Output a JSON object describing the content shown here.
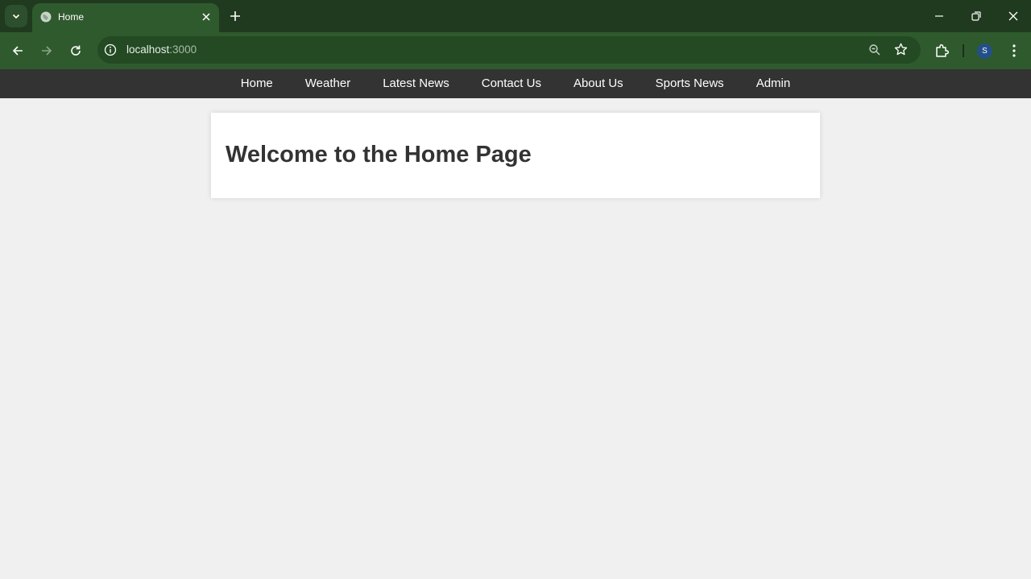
{
  "browser": {
    "tab": {
      "title": "Home"
    },
    "address": {
      "host": "localhost",
      "port": ":3000"
    },
    "profile_initial": "S",
    "colors": {
      "tabstrip": "#1f3a1f",
      "toolbar": "#2f5a2e",
      "omnibox": "#244a24",
      "avatar": "#23508a"
    },
    "icons": {
      "tab_search": "chevron-down-icon",
      "favicon": "globe-icon",
      "tab_close": "close-icon",
      "new_tab": "plus-icon",
      "minimize": "minimize-icon",
      "restore": "restore-icon",
      "close_window": "close-icon",
      "back": "arrow-left-icon",
      "forward": "arrow-right-icon",
      "reload": "reload-icon",
      "site_info": "info-icon",
      "zoom": "zoom-icon",
      "bookmark": "star-icon",
      "extensions": "puzzle-icon",
      "menu": "kebab-menu-icon"
    }
  },
  "site": {
    "nav": {
      "items": [
        {
          "label": "Home"
        },
        {
          "label": "Weather"
        },
        {
          "label": "Latest News"
        },
        {
          "label": "Contact Us"
        },
        {
          "label": "About Us"
        },
        {
          "label": "Sports News"
        },
        {
          "label": "Admin"
        }
      ]
    },
    "heading": "Welcome to the Home Page",
    "colors": {
      "nav_bg": "#333333",
      "page_bg": "#f0f0f0",
      "heading": "#333333"
    }
  }
}
